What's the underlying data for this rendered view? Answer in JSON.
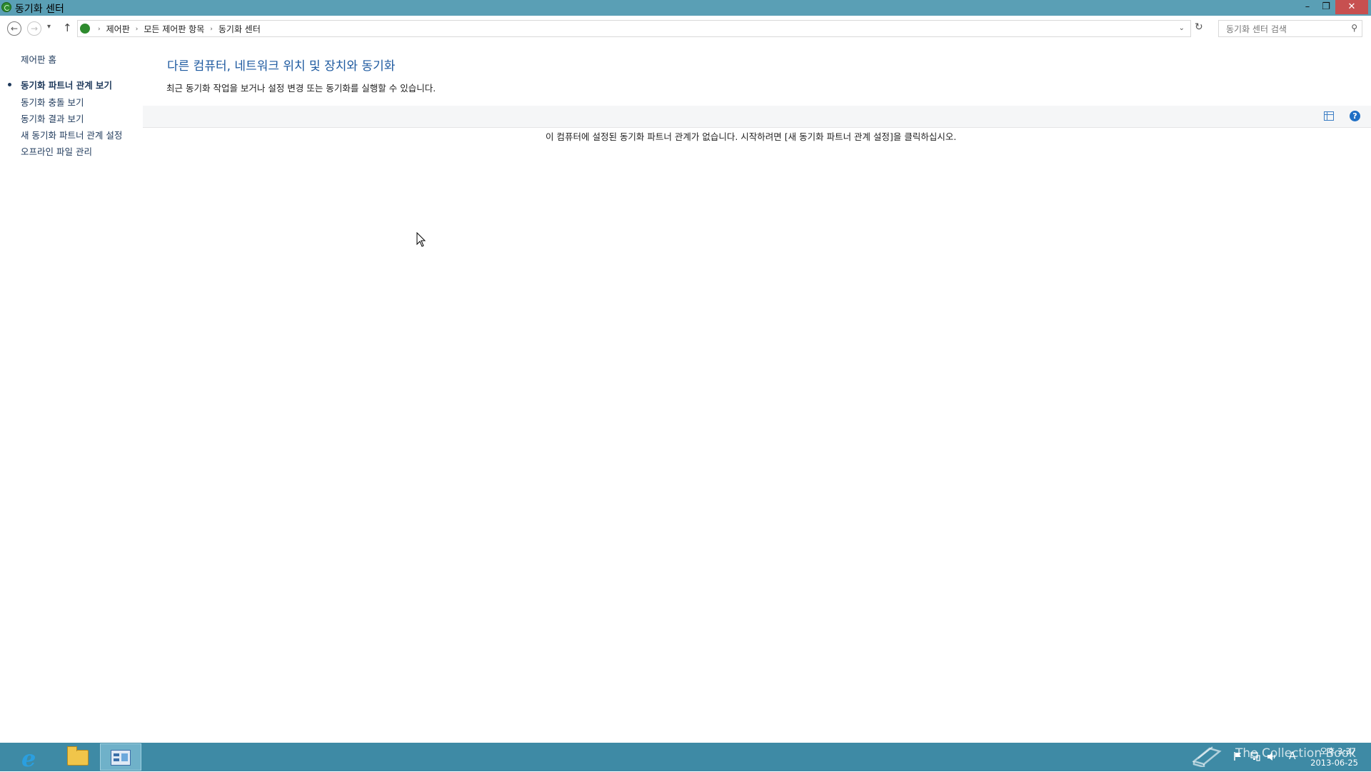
{
  "window": {
    "title": "동기화 센터",
    "controls": {
      "minimize": "–",
      "maximize": "❐",
      "close": "✕"
    }
  },
  "navigation": {
    "back_glyph": "←",
    "forward_glyph": "→",
    "recent_glyph": "▾",
    "up_glyph": "↑",
    "breadcrumb": [
      "제어판",
      "모든 제어판 항목",
      "동기화 센터"
    ],
    "breadcrumb_separator": "›",
    "address_dropdown_glyph": "⌄",
    "refresh_glyph": "↻",
    "search": {
      "placeholder": "동기화 센터 검색",
      "value": ""
    }
  },
  "sidebar": {
    "home": "제어판 홈",
    "items": [
      {
        "label": "동기화 파트너 관계 보기",
        "active": true
      },
      {
        "label": "동기화 충돌 보기",
        "active": false
      },
      {
        "label": "동기화 결과 보기",
        "active": false
      },
      {
        "label": "새 동기화 파트너 관계 설정",
        "active": false
      },
      {
        "label": "오프라인 파일 관리",
        "active": false
      }
    ]
  },
  "main": {
    "title": "다른 컴퓨터, 네트워크 위치 및 장치와 동기화",
    "description": "최근 동기화 작업을 보거나 설정 변경 또는 동기화를 실행할 수 있습니다.",
    "empty_message": "이 컴퓨터에 설정된 동기화 파트너 관계가 없습니다. 시작하려면 [새 동기화 파트너 관계 설정]을 클릭하십시오.",
    "help_glyph": "?"
  },
  "taskbar": {
    "apps": [
      "internet-explorer",
      "file-explorer",
      "control-panel"
    ],
    "ie_glyph": "e",
    "watermark": "The Collection Book",
    "ime": "A",
    "clock": {
      "time": "오후 3:37",
      "date": "2013-06-25"
    }
  },
  "colors": {
    "titlebar": "#5a9fb5",
    "taskbar": "#3e8aa5",
    "link": "#1e395b",
    "heading": "#1e5aa0",
    "close": "#c75050"
  }
}
